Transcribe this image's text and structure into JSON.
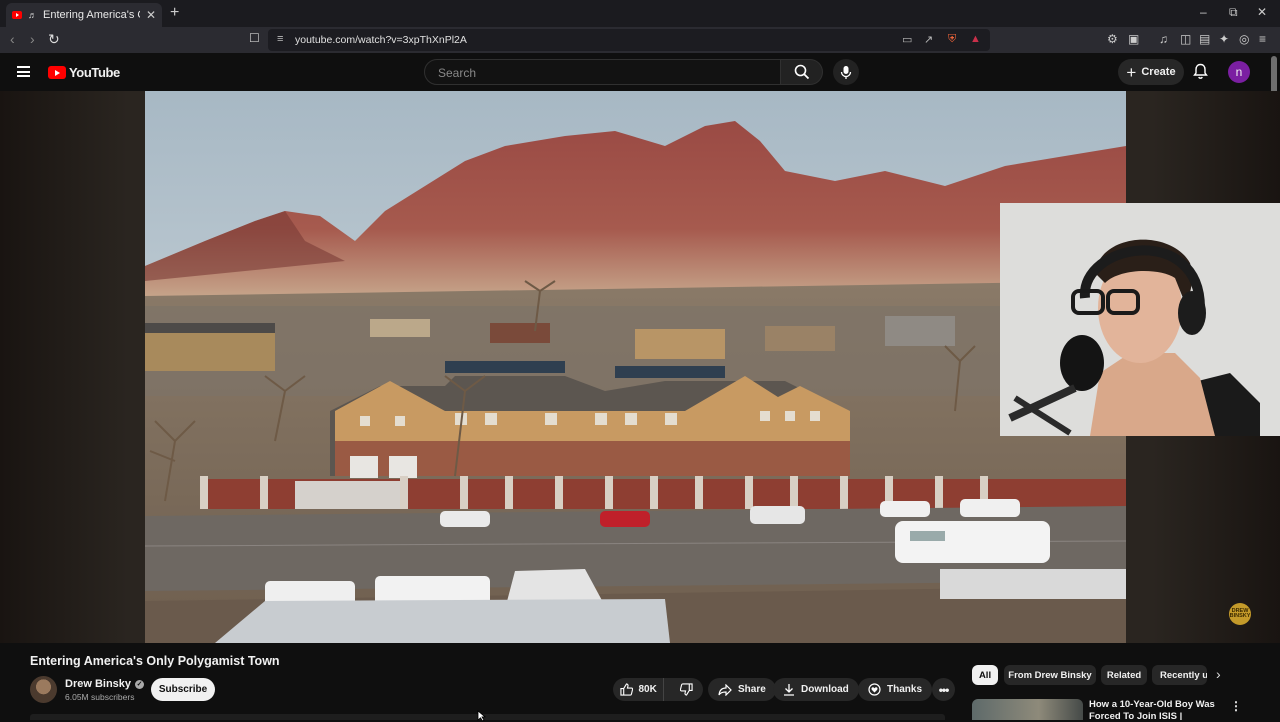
{
  "browser": {
    "tab_title": "Entering America's Only Polygamist Town",
    "url": "youtube.com/watch?v=3xpThXnPl2A"
  },
  "header": {
    "logo_text": "YouTube",
    "search_placeholder": "Search",
    "create_label": "Create",
    "avatar_letter": "n",
    "brand_color": "#ff0000",
    "avatar_color": "#7b1fa2"
  },
  "video": {
    "title": "Entering America's Only Polygamist Town",
    "watermark": "DREW BINSKY"
  },
  "channel": {
    "name": "Drew Binsky",
    "subscribers": "6.05M subscribers",
    "subscribe_label": "Subscribe"
  },
  "actions": {
    "likes": "80K",
    "share": "Share",
    "download": "Download",
    "thanks": "Thanks"
  },
  "chips": [
    "All",
    "From Drew Binsky",
    "Related",
    "Recently uploaded"
  ],
  "recommendations": [
    {
      "title": "How a 10-Year-Old Boy Was Forced To Join ISIS |"
    }
  ]
}
